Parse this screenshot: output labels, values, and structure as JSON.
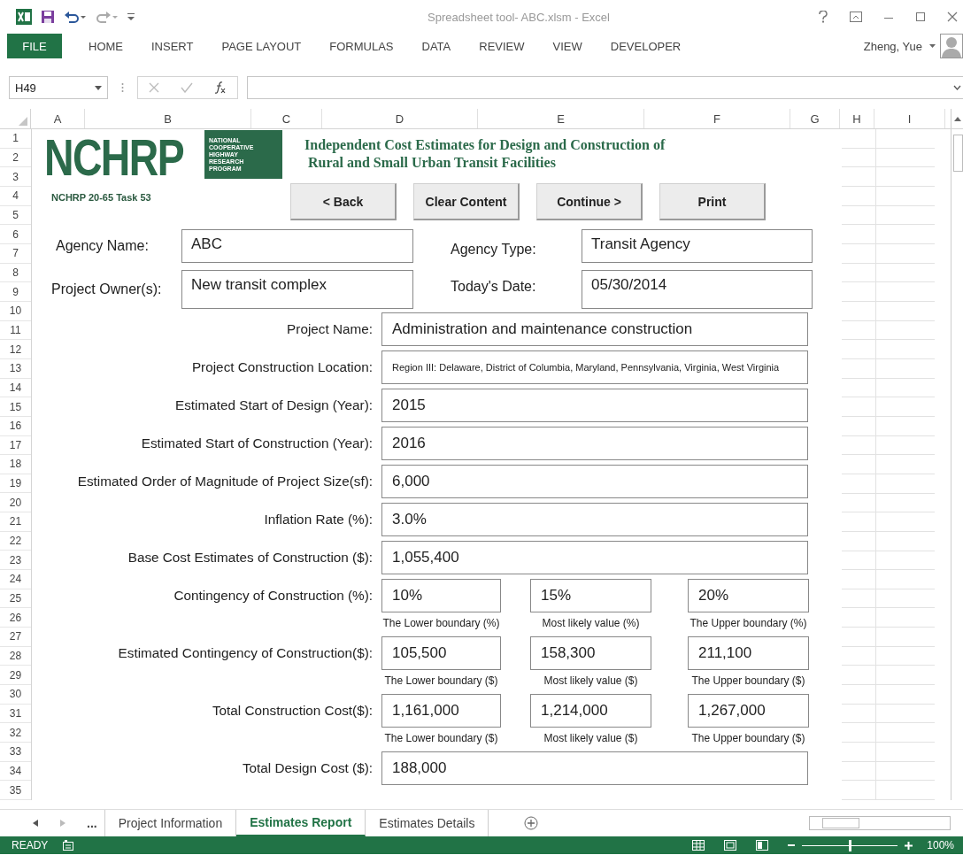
{
  "window": {
    "title": "Spreadsheet tool- ABC.xlsm - Excel",
    "user": "Zheng, Yue"
  },
  "ribbon_tabs": [
    {
      "label": "FILE",
      "kind": "file"
    },
    {
      "label": "HOME",
      "kind": "tab"
    },
    {
      "label": "INSERT",
      "kind": "tab"
    },
    {
      "label": "PAGE LAYOUT",
      "kind": "tab"
    },
    {
      "label": "FORMULAS",
      "kind": "tab"
    },
    {
      "label": "DATA",
      "kind": "tab"
    },
    {
      "label": "REVIEW",
      "kind": "tab"
    },
    {
      "label": "VIEW",
      "kind": "tab"
    },
    {
      "label": "DEVELOPER",
      "kind": "tab"
    }
  ],
  "name_box": "H49",
  "columns": [
    "A",
    "B",
    "C",
    "D",
    "E",
    "F",
    "G",
    "H",
    "I"
  ],
  "rows": [
    "1",
    "2",
    "3",
    "4",
    "5",
    "6",
    "7",
    "8",
    "9",
    "10",
    "11",
    "12",
    "13",
    "14",
    "15",
    "16",
    "17",
    "18",
    "19",
    "20",
    "21",
    "22",
    "23",
    "24",
    "25",
    "26",
    "27",
    "28",
    "29",
    "30",
    "31",
    "32",
    "33",
    "34",
    "35"
  ],
  "header": {
    "logo": "NCHRP",
    "logo_subtitle": [
      "NATIONAL",
      "COOPERATIVE",
      "HIGHWAY",
      "RESEARCH",
      "PROGRAM"
    ],
    "title_lines": [
      "Independent Cost Estimates for Design and Construction of",
      "Rural and Small Urban Transit Facilities"
    ],
    "task": "NCHRP 20-65 Task 53"
  },
  "buttons": [
    "< Back",
    "Clear Content",
    "Continue >",
    "Print"
  ],
  "agency": [
    {
      "label": "Agency Name:",
      "value": "ABC",
      "label2": "Agency Type:",
      "value2": "Transit Agency"
    },
    {
      "label": "Project Owner(s):",
      "value": "New transit complex",
      "label2": "Today's Date:",
      "value2": "05/30/2014"
    }
  ],
  "fields": [
    {
      "kind": "single",
      "label": "Project Name:",
      "value": "Administration and maintenance construction"
    },
    {
      "kind": "small",
      "label": "Project Construction Location:",
      "value": "Region III: Delaware, District of Columbia, Maryland, Pennsylvania, Virginia, West Virginia"
    },
    {
      "kind": "single",
      "label": "Estimated Start of Design (Year):",
      "value": "2015"
    },
    {
      "kind": "single",
      "label": "Estimated Start of Construction (Year):",
      "value": "2016"
    },
    {
      "kind": "single",
      "label": "Estimated Order of Magnitude of Project Size(sf):",
      "value": "6,000"
    },
    {
      "kind": "single",
      "label": "Inflation Rate (%):",
      "value": "3.0%"
    },
    {
      "kind": "single",
      "label": "Base Cost Estimates of Construction ($):",
      "value": "1,055,400"
    },
    {
      "kind": "triple",
      "label": "Contingency of Construction (%):",
      "values": [
        "10%",
        "15%",
        "20%"
      ],
      "captions": [
        "The Lower boundary (%)",
        "Most likely value (%)",
        "The Upper boundary (%)"
      ]
    },
    {
      "kind": "triple",
      "label": "Estimated Contingency of Construction($):",
      "values": [
        "105,500",
        "158,300",
        "211,100"
      ],
      "captions": [
        "The Lower boundary  ($)",
        "Most likely value ($)",
        "The Upper boundary  ($)"
      ]
    },
    {
      "kind": "triple",
      "label": "Total Construction Cost($):",
      "values": [
        "1,161,000",
        "1,214,000",
        "1,267,000"
      ],
      "captions": [
        "The Lower boundary  ($)",
        "Most likely value ($)",
        "The Upper boundary  ($)"
      ]
    },
    {
      "kind": "single",
      "label": "Total Design Cost ($):",
      "value": "188,000"
    }
  ],
  "sheet_tabs": [
    {
      "label": "...",
      "selected": false
    },
    {
      "label": "Project Information",
      "selected": false
    },
    {
      "label": "Estimates Report",
      "selected": true
    },
    {
      "label": "Estimates Details",
      "selected": false
    }
  ],
  "status": "READY",
  "zoom": {
    "label": "100%",
    "level": 0.5
  }
}
